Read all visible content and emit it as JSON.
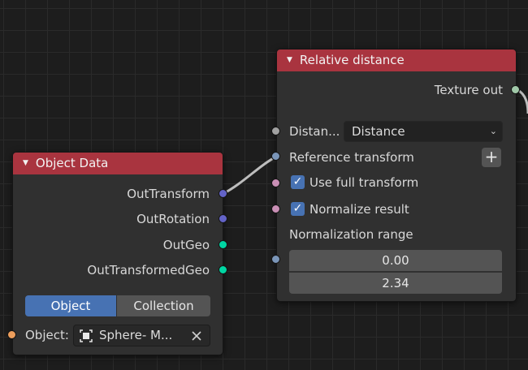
{
  "colors": {
    "header_red": "#a9343f",
    "socket_gray": "#a1a1a1",
    "socket_blue_gray": "#7a95b8",
    "socket_pink": "#c98fb5",
    "socket_green": "#a0c8a8",
    "socket_purple": "#6363c7",
    "socket_teal": "#00d6a3",
    "socket_orange": "#ed9e5c",
    "accent_blue": "#4772b3"
  },
  "relative_distance": {
    "title": "Relative distance",
    "texture_out": "Texture out",
    "distance_label": "Distan...",
    "distance_value": "Distance",
    "reference_transform": "Reference transform",
    "use_full_transform": "Use full transform",
    "use_full_transform_checked": true,
    "normalize_result": "Normalize result",
    "normalize_result_checked": true,
    "normalization_range": "Normalization range",
    "range_min": "0.00",
    "range_max": "2.34"
  },
  "object_data": {
    "title": "Object Data",
    "outputs": [
      "OutTransform",
      "OutRotation",
      "OutGeo",
      "OutTransformedGeo"
    ],
    "tabs": [
      "Object",
      "Collection"
    ],
    "active_tab": "Object",
    "object_label": "Object:",
    "object_value": "Sphere- M..."
  },
  "icons": {
    "collapse": "collapse-arrow-icon",
    "chevron": "chevron-down-icon",
    "plus": "plus-icon",
    "check": "checkmark-icon",
    "object": "object-icon",
    "close": "close-icon"
  }
}
